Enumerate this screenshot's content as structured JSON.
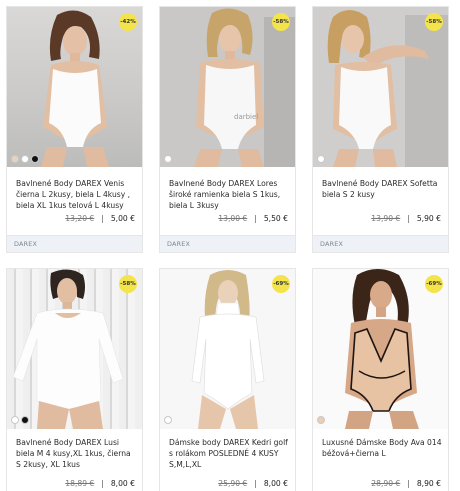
{
  "products": [
    {
      "title": "Bavlnené Body DAREX Venis čierna L 2kusy, biela L 4kusy , biela XL 1kus  telová L 4kusy",
      "badge": "-42%",
      "old_price": "13,20 €",
      "new_price": "5,00 €",
      "brand": "DAREX",
      "swatches": [
        "#e8d2bf",
        "#ffffff",
        "#111111"
      ]
    },
    {
      "title": "Bavlnené Body DAREX Lores široké ramienka biela S 1kus, biela L 3kusy",
      "badge": "-58%",
      "old_price": "13,00 €",
      "new_price": "5,50 €",
      "brand": "DAREX",
      "swatches": [
        "#ffffff"
      ]
    },
    {
      "title": "Bavlnené Body DAREX Sofetta biela S 2 kusy",
      "badge": "-58%",
      "old_price": "13,90 €",
      "new_price": "5,90 €",
      "brand": "DAREX",
      "swatches": [
        "#ffffff"
      ]
    },
    {
      "title": "Bavlnené Body DAREX Lusi biela M 4 kusy,XL 1kus, čierna S 2kusy, XL 1kus",
      "badge": "-58%",
      "old_price": "18,89 €",
      "new_price": "8,00 €",
      "swatches": [
        "#ffffff",
        "#111111"
      ]
    },
    {
      "title": "Dámske body DAREX Kedri golf s rolákom POSLEDNÉ 4 KUSY S,M,L,XL",
      "badge": "-69%",
      "old_price": "25,90 €",
      "new_price": "8,00 €",
      "swatches": [
        "#ffffff"
      ]
    },
    {
      "title": "Luxusné Dámske Body Ava 014 béžová+čierna L",
      "badge": "-69%",
      "old_price": "28,90 €",
      "new_price": "8,90 €",
      "swatches": [
        "#e8cfb6"
      ]
    }
  ],
  "watermark": "darbiel"
}
